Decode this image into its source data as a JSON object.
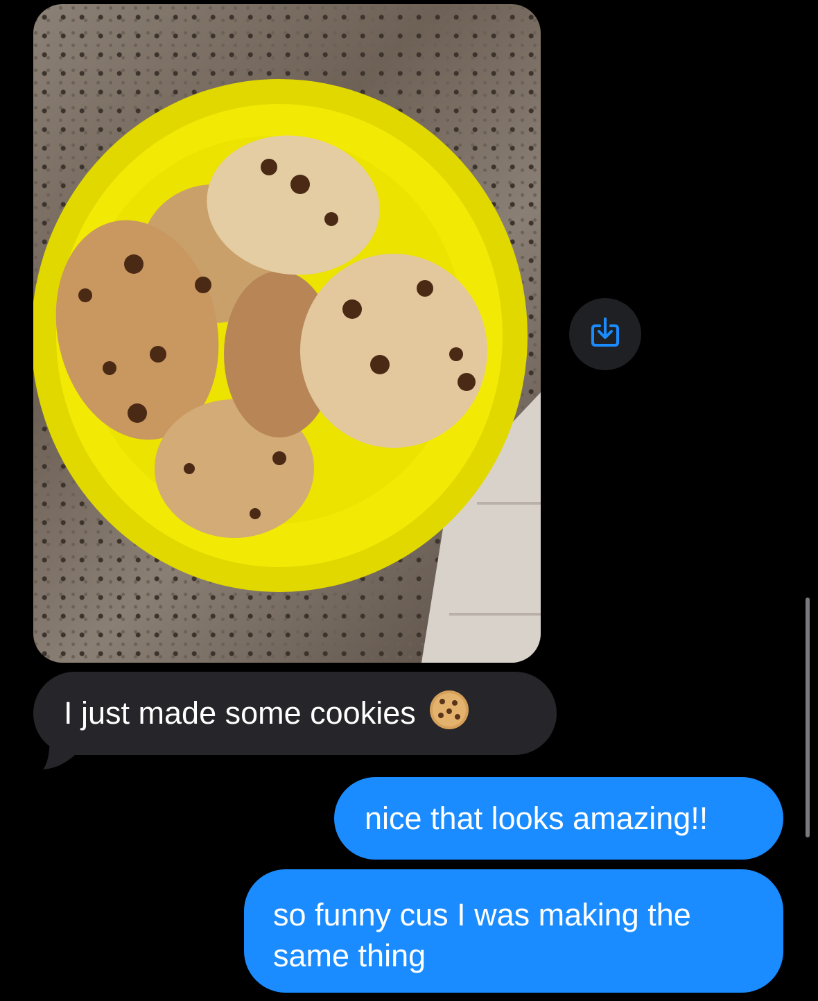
{
  "conversation": {
    "incoming": {
      "photo_alt_icon": "photo-attachment",
      "save_icon": "download-icon",
      "text": "I just made some cookies",
      "emoji_icon": "cookie-emoji"
    },
    "outgoing": [
      {
        "text": "nice that looks amazing!!"
      },
      {
        "text": "so funny cus I was making the same thing"
      }
    ]
  },
  "colors": {
    "background": "#000000",
    "incoming_bubble": "#26262a",
    "outgoing_bubble": "#1a8cff",
    "accent": "#1a8cff"
  }
}
